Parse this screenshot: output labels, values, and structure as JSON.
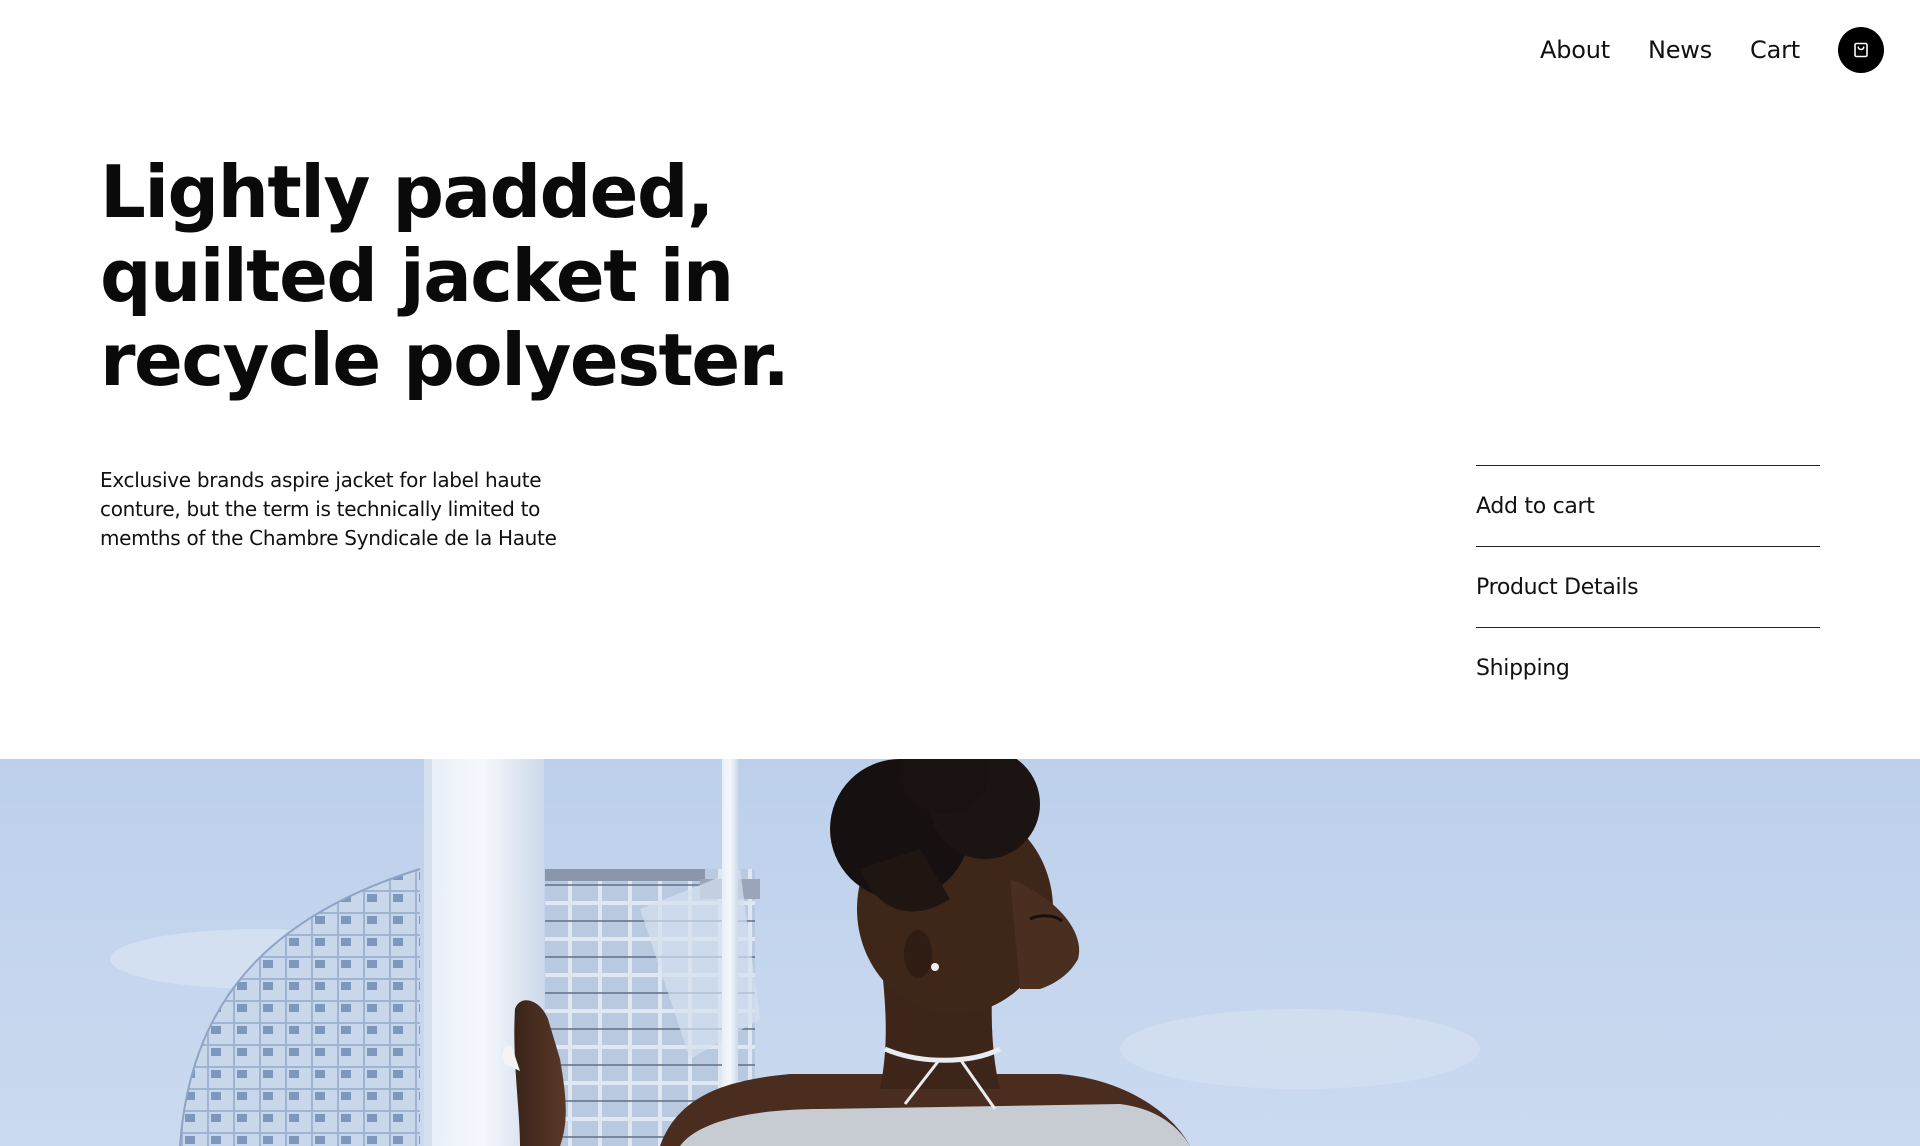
{
  "nav": {
    "links": [
      "About",
      "News",
      "Cart"
    ],
    "cart_icon": "shopping-bag-icon"
  },
  "product": {
    "headline": "Lightly padded, quilted jacket in recycle polyester.",
    "headline_lines": [
      "Lightly padded,",
      "quilted jacket in",
      "recycle polyester."
    ],
    "description": "Exclusive brands aspire jacket for label haute conture, but the term is technically limited to memths of the Chambre Syndicale de la Haute"
  },
  "accordion": {
    "items": [
      "Add to cart",
      "Product Details",
      "Shipping"
    ]
  },
  "colors": {
    "text": "#111111",
    "background": "#ffffff",
    "icon_bg": "#000000",
    "sky": "#c4d6ee"
  }
}
